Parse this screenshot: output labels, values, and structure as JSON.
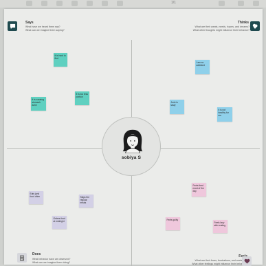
{
  "toolbar": {
    "zoom_label": "1/1"
  },
  "persona": {
    "name": "sobiya  S"
  },
  "quadrants": {
    "says": {
      "title": "Says",
      "subtitle_1": "What have we heard them say?",
      "subtitle_2": "What can we imagine them saying?"
    },
    "thinks": {
      "title": "Thinks",
      "subtitle_1": "What are their wants, needs, hopes, and dreams?",
      "subtitle_2": "What other thoughts might influence their behavior?"
    },
    "does": {
      "title": "Does",
      "subtitle_1": "What behavior have we observed?",
      "subtitle_2": "What can we imagine them doing?"
    },
    "feels": {
      "title": "Feels",
      "subtitle_1": "What are their fears, frustrations, and anxieties?",
      "subtitle_2": "What other feelings might influence their behavior?"
    }
  },
  "colors": {
    "says_note": "#5fd0c0",
    "thinks_note": "#8fd0ea",
    "does_note": "#d3d0e6",
    "feels_note": "#efc7dc"
  },
  "icons": {
    "says": "speech-bubble-icon",
    "thinks": "thought-cloud-icon",
    "does": "document-icon",
    "feels": "heart-icon"
  },
  "notes": {
    "says": [
      "It is hard to find",
      "It is causing stomach ache",
      "It is too less portion"
    ],
    "thinks": [
      "I am so addicted",
      "Junk is tasty",
      "It is not healthy for me"
    ],
    "does": [
      "Eats junk food often",
      "Skips the regular meals",
      "Orders food at midnight"
    ],
    "feels": [
      "Feels tired most of the day",
      "Feels guilty",
      "Feels lazy after eating"
    ]
  }
}
